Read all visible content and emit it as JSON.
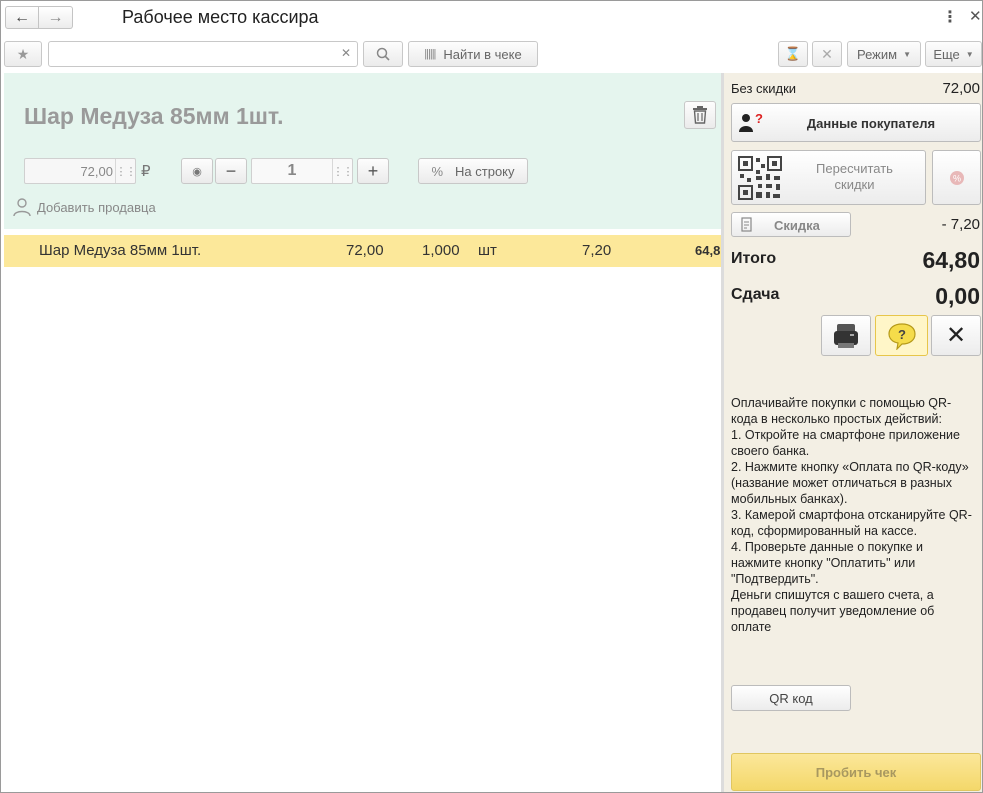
{
  "window": {
    "title": "Рабочее место кассира"
  },
  "toolbar": {
    "search_value": "",
    "find_in_check_label": "Найти в чеке",
    "mode_label": "Режим",
    "more_label": "Еще"
  },
  "product_card": {
    "title": "Шар Медуза 85мм 1шт.",
    "price": "72,00",
    "currency": "₽",
    "quantity": "1",
    "per_line_label": "На строку",
    "percent_sign": "%",
    "add_seller_label": "Добавить продавца"
  },
  "check_rows": [
    {
      "name": "Шар Медуза 85мм 1шт.",
      "price": "72,00",
      "quantity": "1,000",
      "unit": "шт",
      "discount": "7,20",
      "sum": "64,8"
    }
  ],
  "summary": {
    "no_discount_label": "Без скидки",
    "no_discount_value": "72,00",
    "customer_data_label": "Данные покупателя",
    "recalc_line1": "Пересчитать",
    "recalc_line2": "скидки",
    "discount_label": "Скидка",
    "discount_value": "- 7,20",
    "total_label": "Итого",
    "total_value": "64,80",
    "change_label": "Сдача",
    "change_value": "0,00"
  },
  "qr_info": {
    "lines": [
      "Оплачивайте покупки с помощью QR-кода в несколько простых действий:",
      "1. Откройте на смартфоне приложение своего банка.",
      "2. Нажмите кнопку «Оплата по QR-коду» (название может отличаться в разных мобильных банках).",
      "3. Камерой смартфона отсканируйте QR-код, сформированный на кассе.",
      "4. Проверьте данные о покупке и нажмите кнопку \"Оплатить\" или \"Подтвердить\".",
      "Деньги спишутся с вашего счета, а продавец получит уведомление об оплате"
    ],
    "qr_button_label": "QR код"
  },
  "print_check_label": "Пробить чек",
  "colors": {
    "card_bg": "#e5f5ee",
    "row_highlight": "#fce89a",
    "right_pane_bg": "#f3efe4",
    "print_button": "#f4d86a"
  }
}
